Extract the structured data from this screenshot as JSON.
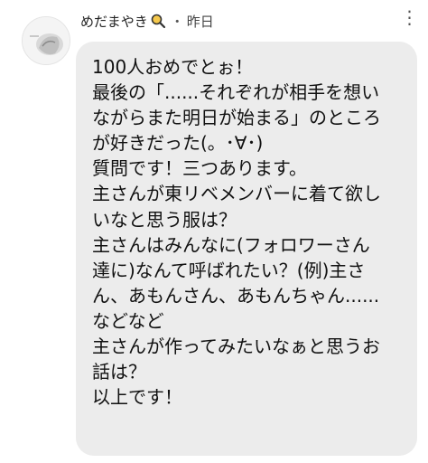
{
  "post": {
    "author_name": "めだまやき",
    "separator": "・",
    "timestamp": "昨日",
    "more_label": "⋮",
    "lines": [
      "100人おめでとぉ！",
      "最後の「......それぞれが相手を想い",
      "ながらまた明日が始まる」のところ",
      "が好きだった(。･∀･)",
      "質問です！三つあります。",
      "主さんが東リベメンバーに着て欲し",
      "いなと思う服は？",
      "主さんはみんなに(フォロワーさん",
      "達に)なんて呼ばれたい？(例)主さ",
      "ん、あもんさん、あもんちゃん......",
      "などなど",
      "主さんが作ってみたいなぁと思うお",
      "話は？",
      "以上です！"
    ]
  },
  "icons": {
    "author_emoji": "magnifier-icon",
    "more": "more-options-icon"
  },
  "colors": {
    "bubble": "#ececec",
    "text": "#111111",
    "meta": "#444444"
  }
}
